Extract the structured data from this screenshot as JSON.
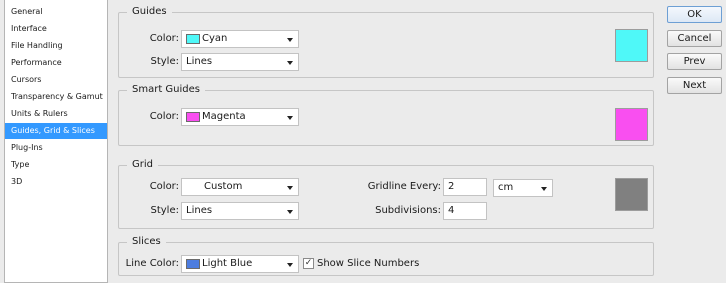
{
  "sidebar": {
    "items": [
      {
        "label": "General"
      },
      {
        "label": "Interface"
      },
      {
        "label": "File Handling"
      },
      {
        "label": "Performance"
      },
      {
        "label": "Cursors"
      },
      {
        "label": "Transparency & Gamut"
      },
      {
        "label": "Units & Rulers"
      },
      {
        "label": "Guides, Grid & Slices",
        "selected": true
      },
      {
        "label": "Plug-Ins"
      },
      {
        "label": "Type"
      },
      {
        "label": "3D"
      }
    ]
  },
  "guides": {
    "title": "Guides",
    "color_label": "Color:",
    "color_value": "Cyan",
    "color_hex": "#4ff8f8",
    "style_label": "Style:",
    "style_value": "Lines"
  },
  "smart_guides": {
    "title": "Smart Guides",
    "color_label": "Color:",
    "color_value": "Magenta",
    "color_hex": "#f94ff0"
  },
  "grid": {
    "title": "Grid",
    "color_label": "Color:",
    "color_value": "Custom",
    "style_label": "Style:",
    "style_value": "Lines",
    "gridline_label": "Gridline Every:",
    "gridline_value": "2",
    "unit_value": "cm",
    "subdivisions_label": "Subdivisions:",
    "subdivisions_value": "4",
    "color_hex": "#808080"
  },
  "slices": {
    "title": "Slices",
    "line_color_label": "Line Color:",
    "line_color_value": "Light Blue",
    "line_color_hex": "#4d7de0",
    "show_numbers_label": "Show Slice Numbers",
    "show_numbers_checked": true
  },
  "buttons": {
    "ok": "OK",
    "cancel": "Cancel",
    "prev": "Prev",
    "next": "Next"
  }
}
